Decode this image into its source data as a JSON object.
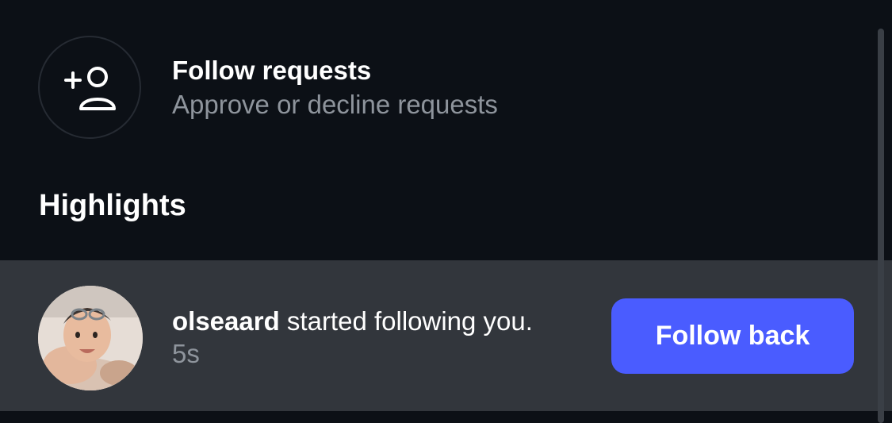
{
  "follow_requests": {
    "title": "Follow requests",
    "subtitle": "Approve or decline requests",
    "icon": "add-user-icon"
  },
  "highlights": {
    "heading": "Highlights",
    "items": [
      {
        "username": "olseaard",
        "action": " started following you.",
        "time": "5s",
        "avatar": "profile-photo",
        "button_label": "Follow back",
        "button_color": "#4a5cff"
      }
    ]
  },
  "colors": {
    "background": "#0c1016",
    "row_background": "#32363c",
    "muted_text": "#8e949c",
    "accent": "#4a5cff"
  }
}
